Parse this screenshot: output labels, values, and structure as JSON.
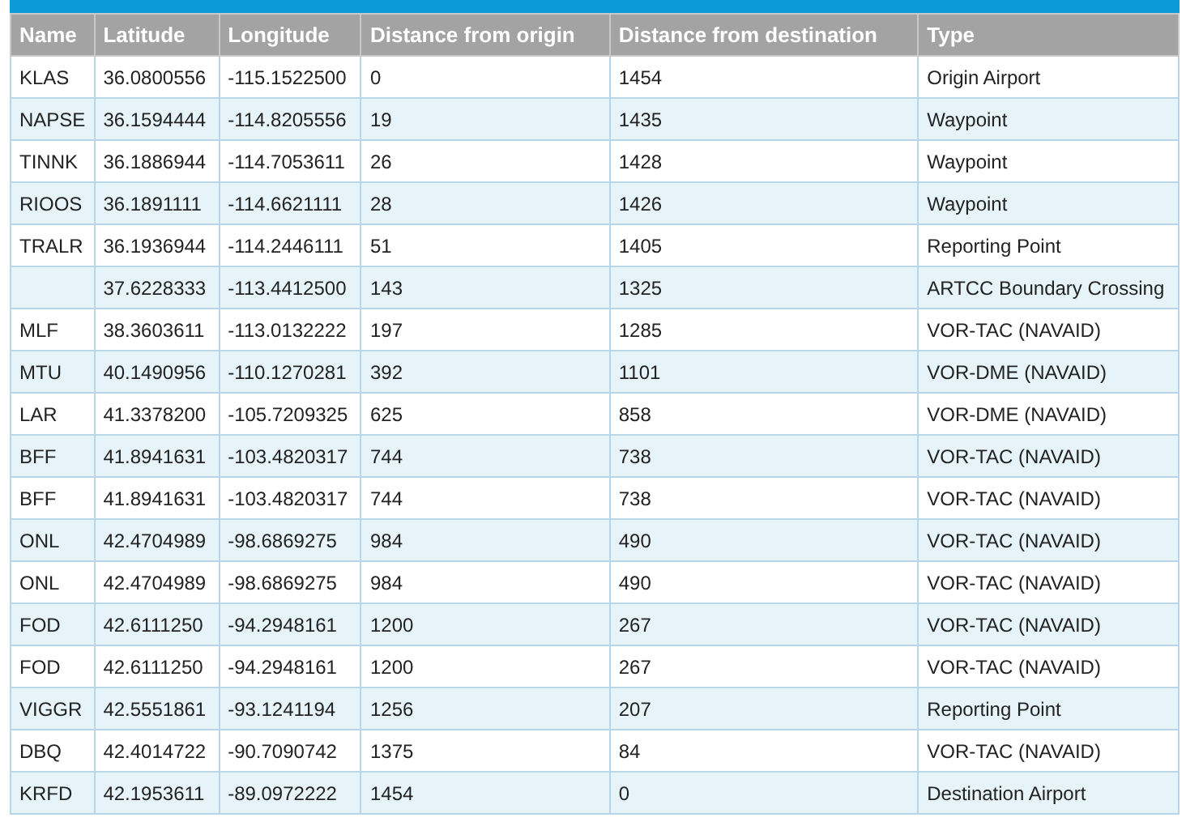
{
  "table": {
    "columns": [
      "Name",
      "Latitude",
      "Longitude",
      "Distance from origin",
      "Distance from destination",
      "Type"
    ],
    "rows": [
      {
        "name": "KLAS",
        "latitude": "36.0800556",
        "longitude": "-115.1522500",
        "from_origin": "0",
        "from_destination": "1454",
        "type": "Origin Airport"
      },
      {
        "name": "NAPSE",
        "latitude": "36.1594444",
        "longitude": "-114.8205556",
        "from_origin": "19",
        "from_destination": "1435",
        "type": "Waypoint"
      },
      {
        "name": "TINNK",
        "latitude": "36.1886944",
        "longitude": "-114.7053611",
        "from_origin": "26",
        "from_destination": "1428",
        "type": "Waypoint"
      },
      {
        "name": "RIOOS",
        "latitude": "36.1891111",
        "longitude": "-114.6621111",
        "from_origin": "28",
        "from_destination": "1426",
        "type": "Waypoint"
      },
      {
        "name": "TRALR",
        "latitude": "36.1936944",
        "longitude": "-114.2446111",
        "from_origin": "51",
        "from_destination": "1405",
        "type": "Reporting Point"
      },
      {
        "latitude": "37.6228333",
        "longitude": "-113.4412500",
        "from_origin": "143",
        "from_destination": "1325",
        "type": "ARTCC Boundary Crossing"
      },
      {
        "name": "MLF",
        "latitude": "38.3603611",
        "longitude": "-113.0132222",
        "from_origin": "197",
        "from_destination": "1285",
        "type": "VOR-TAC (NAVAID)"
      },
      {
        "name": "MTU",
        "latitude": "40.1490956",
        "longitude": "-110.1270281",
        "from_origin": "392",
        "from_destination": "1101",
        "type": "VOR-DME (NAVAID)"
      },
      {
        "name": "LAR",
        "latitude": "41.3378200",
        "longitude": "-105.7209325",
        "from_origin": "625",
        "from_destination": "858",
        "type": "VOR-DME (NAVAID)"
      },
      {
        "name": "BFF",
        "latitude": "41.8941631",
        "longitude": "-103.4820317",
        "from_origin": "744",
        "from_destination": "738",
        "type": "VOR-TAC (NAVAID)"
      },
      {
        "name": "BFF",
        "latitude": "41.8941631",
        "longitude": "-103.4820317",
        "from_origin": "744",
        "from_destination": "738",
        "type": "VOR-TAC (NAVAID)"
      },
      {
        "name": "ONL",
        "latitude": "42.4704989",
        "longitude": "-98.6869275",
        "from_origin": "984",
        "from_destination": "490",
        "type": "VOR-TAC (NAVAID)"
      },
      {
        "name": "ONL",
        "latitude": "42.4704989",
        "longitude": "-98.6869275",
        "from_origin": "984",
        "from_destination": "490",
        "type": "VOR-TAC (NAVAID)"
      },
      {
        "name": "FOD",
        "latitude": "42.6111250",
        "longitude": "-94.2948161",
        "from_origin": "1200",
        "from_destination": "267",
        "type": "VOR-TAC (NAVAID)"
      },
      {
        "name": "FOD",
        "latitude": "42.6111250",
        "longitude": "-94.2948161",
        "from_origin": "1200",
        "from_destination": "267",
        "type": "VOR-TAC (NAVAID)"
      },
      {
        "name": "VIGGR",
        "latitude": "42.5551861",
        "longitude": "-93.1241194",
        "from_origin": "1256",
        "from_destination": "207",
        "type": "Reporting Point"
      },
      {
        "name": "DBQ",
        "latitude": "42.4014722",
        "longitude": "-90.7090742",
        "from_origin": "1375",
        "from_destination": "84",
        "type": "VOR-TAC (NAVAID)"
      },
      {
        "name": "KRFD",
        "latitude": "42.1953611",
        "longitude": "-89.0972222",
        "from_origin": "1454",
        "from_destination": "0",
        "type": "Destination Airport"
      }
    ]
  }
}
